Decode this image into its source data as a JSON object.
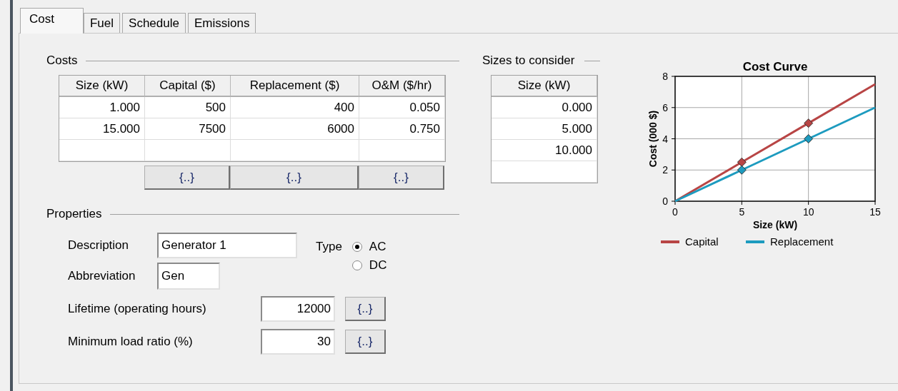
{
  "tabs": [
    {
      "label": "Cost",
      "selected": true
    },
    {
      "label": "Fuel",
      "selected": false
    },
    {
      "label": "Schedule",
      "selected": false
    },
    {
      "label": "Emissions",
      "selected": false
    }
  ],
  "costs": {
    "title": "Costs",
    "columns": [
      "Size (kW)",
      "Capital ($)",
      "Replacement ($)",
      "O&M ($/hr)"
    ],
    "rows": [
      [
        "1.000",
        "500",
        "400",
        "0.050"
      ],
      [
        "15.000",
        "7500",
        "6000",
        "0.750"
      ]
    ],
    "column_buttons": [
      "{..}",
      "{..}",
      "{..}"
    ]
  },
  "sizes": {
    "title": "Sizes to consider",
    "columns": [
      "Size (kW)"
    ],
    "rows": [
      [
        "0.000"
      ],
      [
        "5.000"
      ],
      [
        "10.000"
      ]
    ]
  },
  "properties": {
    "title": "Properties",
    "description": {
      "label": "Description",
      "value": "Generator 1"
    },
    "abbreviation": {
      "label": "Abbreviation",
      "value": "Gen"
    },
    "type": {
      "label": "Type",
      "options": [
        {
          "label": "AC",
          "selected": true
        },
        {
          "label": "DC",
          "selected": false
        }
      ]
    },
    "lifetime": {
      "label": "Lifetime (operating hours)",
      "value": "12000",
      "button": "{..}"
    },
    "min_load": {
      "label": "Minimum load ratio (%)",
      "value": "30",
      "button": "{..}"
    }
  },
  "chart": {
    "chart_data": {
      "type": "line",
      "title": "Cost Curve",
      "xlabel": "Size (kW)",
      "ylabel": "Cost (000 $)",
      "x": [
        0,
        5,
        10,
        15
      ],
      "series": [
        {
          "name": "Capital",
          "color": "#b84545",
          "values": [
            0,
            2.5,
            5,
            7.5
          ]
        },
        {
          "name": "Replacement",
          "color": "#1d9bbf",
          "values": [
            0,
            2,
            4,
            6
          ]
        }
      ],
      "grid": true,
      "legend": true,
      "xlim": [
        0,
        15
      ],
      "ylim": [
        0,
        8
      ],
      "xticks": [
        0,
        5,
        10,
        15
      ],
      "yticks": [
        0,
        2,
        4,
        6,
        8
      ]
    }
  }
}
